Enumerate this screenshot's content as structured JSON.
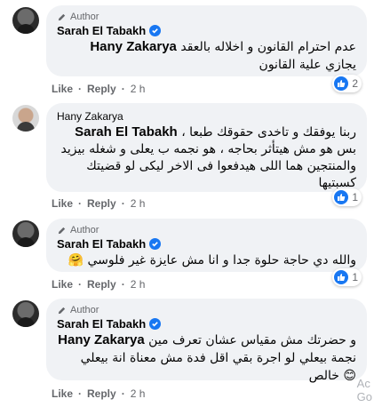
{
  "badges": {
    "author": "Author"
  },
  "actions": {
    "like": "Like",
    "reply": "Reply",
    "separator": "·",
    "time": "2 h"
  },
  "icons": {
    "author": "pen-icon",
    "verified": "verified-badge-icon",
    "like": "like-icon"
  },
  "colors": {
    "accent": "#1877f2",
    "bubble": "#f0f2f5",
    "muted": "#65676b"
  },
  "comments": [
    {
      "author": "Sarah El Tabakh",
      "is_author": true,
      "verified": true,
      "mention": "Hany Zakarya",
      "text": "عدم احترام القانون و اخلاله بالعقد يجازي علية القانون",
      "reactions": {
        "count": "2"
      }
    },
    {
      "author": "Hany Zakarya",
      "is_author": false,
      "verified": false,
      "mention": "Sarah El Tabakh",
      "text": "ربنا يوفقك و تاخدى حقوقك طبعا ، بس هو مش هيتأثر بحاجه ، هو نجمه ب يعلى و شغله بيزيد والمنتجين هما اللى هيدفعوا فى الاخر ليكى لو قضيتك كسبتيها",
      "reactions": {
        "count": "1"
      }
    },
    {
      "author": "Sarah El Tabakh",
      "is_author": true,
      "verified": true,
      "text": "والله دي حاجة حلوة جدا و انا مش عايزة غير فلوسي 🤗",
      "reactions": {
        "count": "1"
      }
    },
    {
      "author": "Sarah El Tabakh",
      "is_author": true,
      "verified": true,
      "mention": "Hany Zakarya",
      "text": "و حضرتك مش مقياس عشان تعرف مين نجمة بيعلي لو اجرة بقي اقل فدة مش معناة انة بيعلي خالص 😊"
    }
  ],
  "watermark": {
    "line1": "Ac",
    "line2": "Go"
  }
}
